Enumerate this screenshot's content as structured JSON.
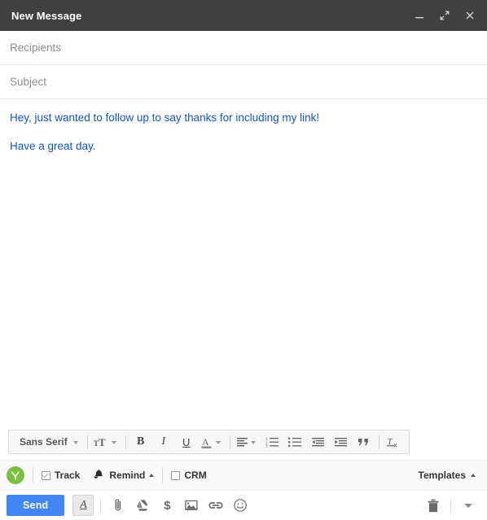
{
  "window": {
    "title": "New Message",
    "controls": [
      {
        "name": "minimize",
        "label": "Minimize"
      },
      {
        "name": "expand",
        "label": "Full screen"
      },
      {
        "name": "close",
        "label": "Save & close"
      }
    ]
  },
  "fields": {
    "recipients": {
      "placeholder": "Recipients",
      "value": ""
    },
    "subject": {
      "placeholder": "Subject",
      "value": ""
    }
  },
  "body": {
    "text_color": "#1155cc",
    "paragraphs": [
      "Hey, just wanted to follow up to say thanks for including my link!",
      "Have a great day."
    ]
  },
  "format_toolbar": {
    "font": {
      "label": "Sans Serif",
      "caret": "chevron-down-icon"
    },
    "items": [
      {
        "name": "font-size",
        "label": "ᴛT",
        "icon": "text-size-icon",
        "caret": true
      },
      {
        "name": "bold",
        "label": "B",
        "icon": "bold-icon"
      },
      {
        "name": "italic",
        "label": "I",
        "icon": "italic-icon"
      },
      {
        "name": "underline",
        "label": "U",
        "icon": "underline-icon"
      },
      {
        "name": "text-color",
        "label": "A",
        "icon": "text-color-icon",
        "caret": true
      },
      {
        "name": "align",
        "label": "",
        "icon": "align-icon",
        "caret": true
      },
      {
        "name": "numbered-list",
        "label": "",
        "icon": "numbered-list-icon"
      },
      {
        "name": "bulleted-list",
        "label": "",
        "icon": "bulleted-list-icon"
      },
      {
        "name": "indent-less",
        "label": "",
        "icon": "indent-less-icon"
      },
      {
        "name": "indent-more",
        "label": "",
        "icon": "indent-more-icon"
      },
      {
        "name": "quote",
        "label": "”",
        "icon": "quote-icon"
      },
      {
        "name": "remove-formatting",
        "label": "",
        "icon": "remove-formatting-icon"
      }
    ]
  },
  "plugin_bar": {
    "brand": {
      "name": "yesware-logo",
      "letter": "y",
      "color": "#7ac143"
    },
    "track": {
      "label": "Track",
      "checked": true
    },
    "remind": {
      "label": "Remind",
      "icon": "bell-icon",
      "caret": "chevron-up-icon"
    },
    "crm": {
      "label": "CRM",
      "checked": false
    },
    "templates": {
      "label": "Templates",
      "caret": "chevron-up-icon"
    }
  },
  "action_bar": {
    "send": {
      "label": "Send",
      "color": "#4285f4"
    },
    "tools": [
      {
        "name": "formatting-options",
        "icon": "underlined-a-icon",
        "pressed": true
      },
      {
        "name": "attach-files",
        "icon": "paperclip-icon"
      },
      {
        "name": "insert-drive",
        "icon": "google-drive-icon"
      },
      {
        "name": "insert-money",
        "icon": "dollar-icon"
      },
      {
        "name": "insert-photo",
        "icon": "image-icon"
      },
      {
        "name": "insert-link",
        "icon": "link-icon"
      },
      {
        "name": "insert-emoji",
        "icon": "emoji-icon"
      }
    ],
    "discard": {
      "name": "discard-draft",
      "icon": "trash-icon"
    },
    "more": {
      "name": "more-options",
      "icon": "chevron-down-icon"
    }
  }
}
